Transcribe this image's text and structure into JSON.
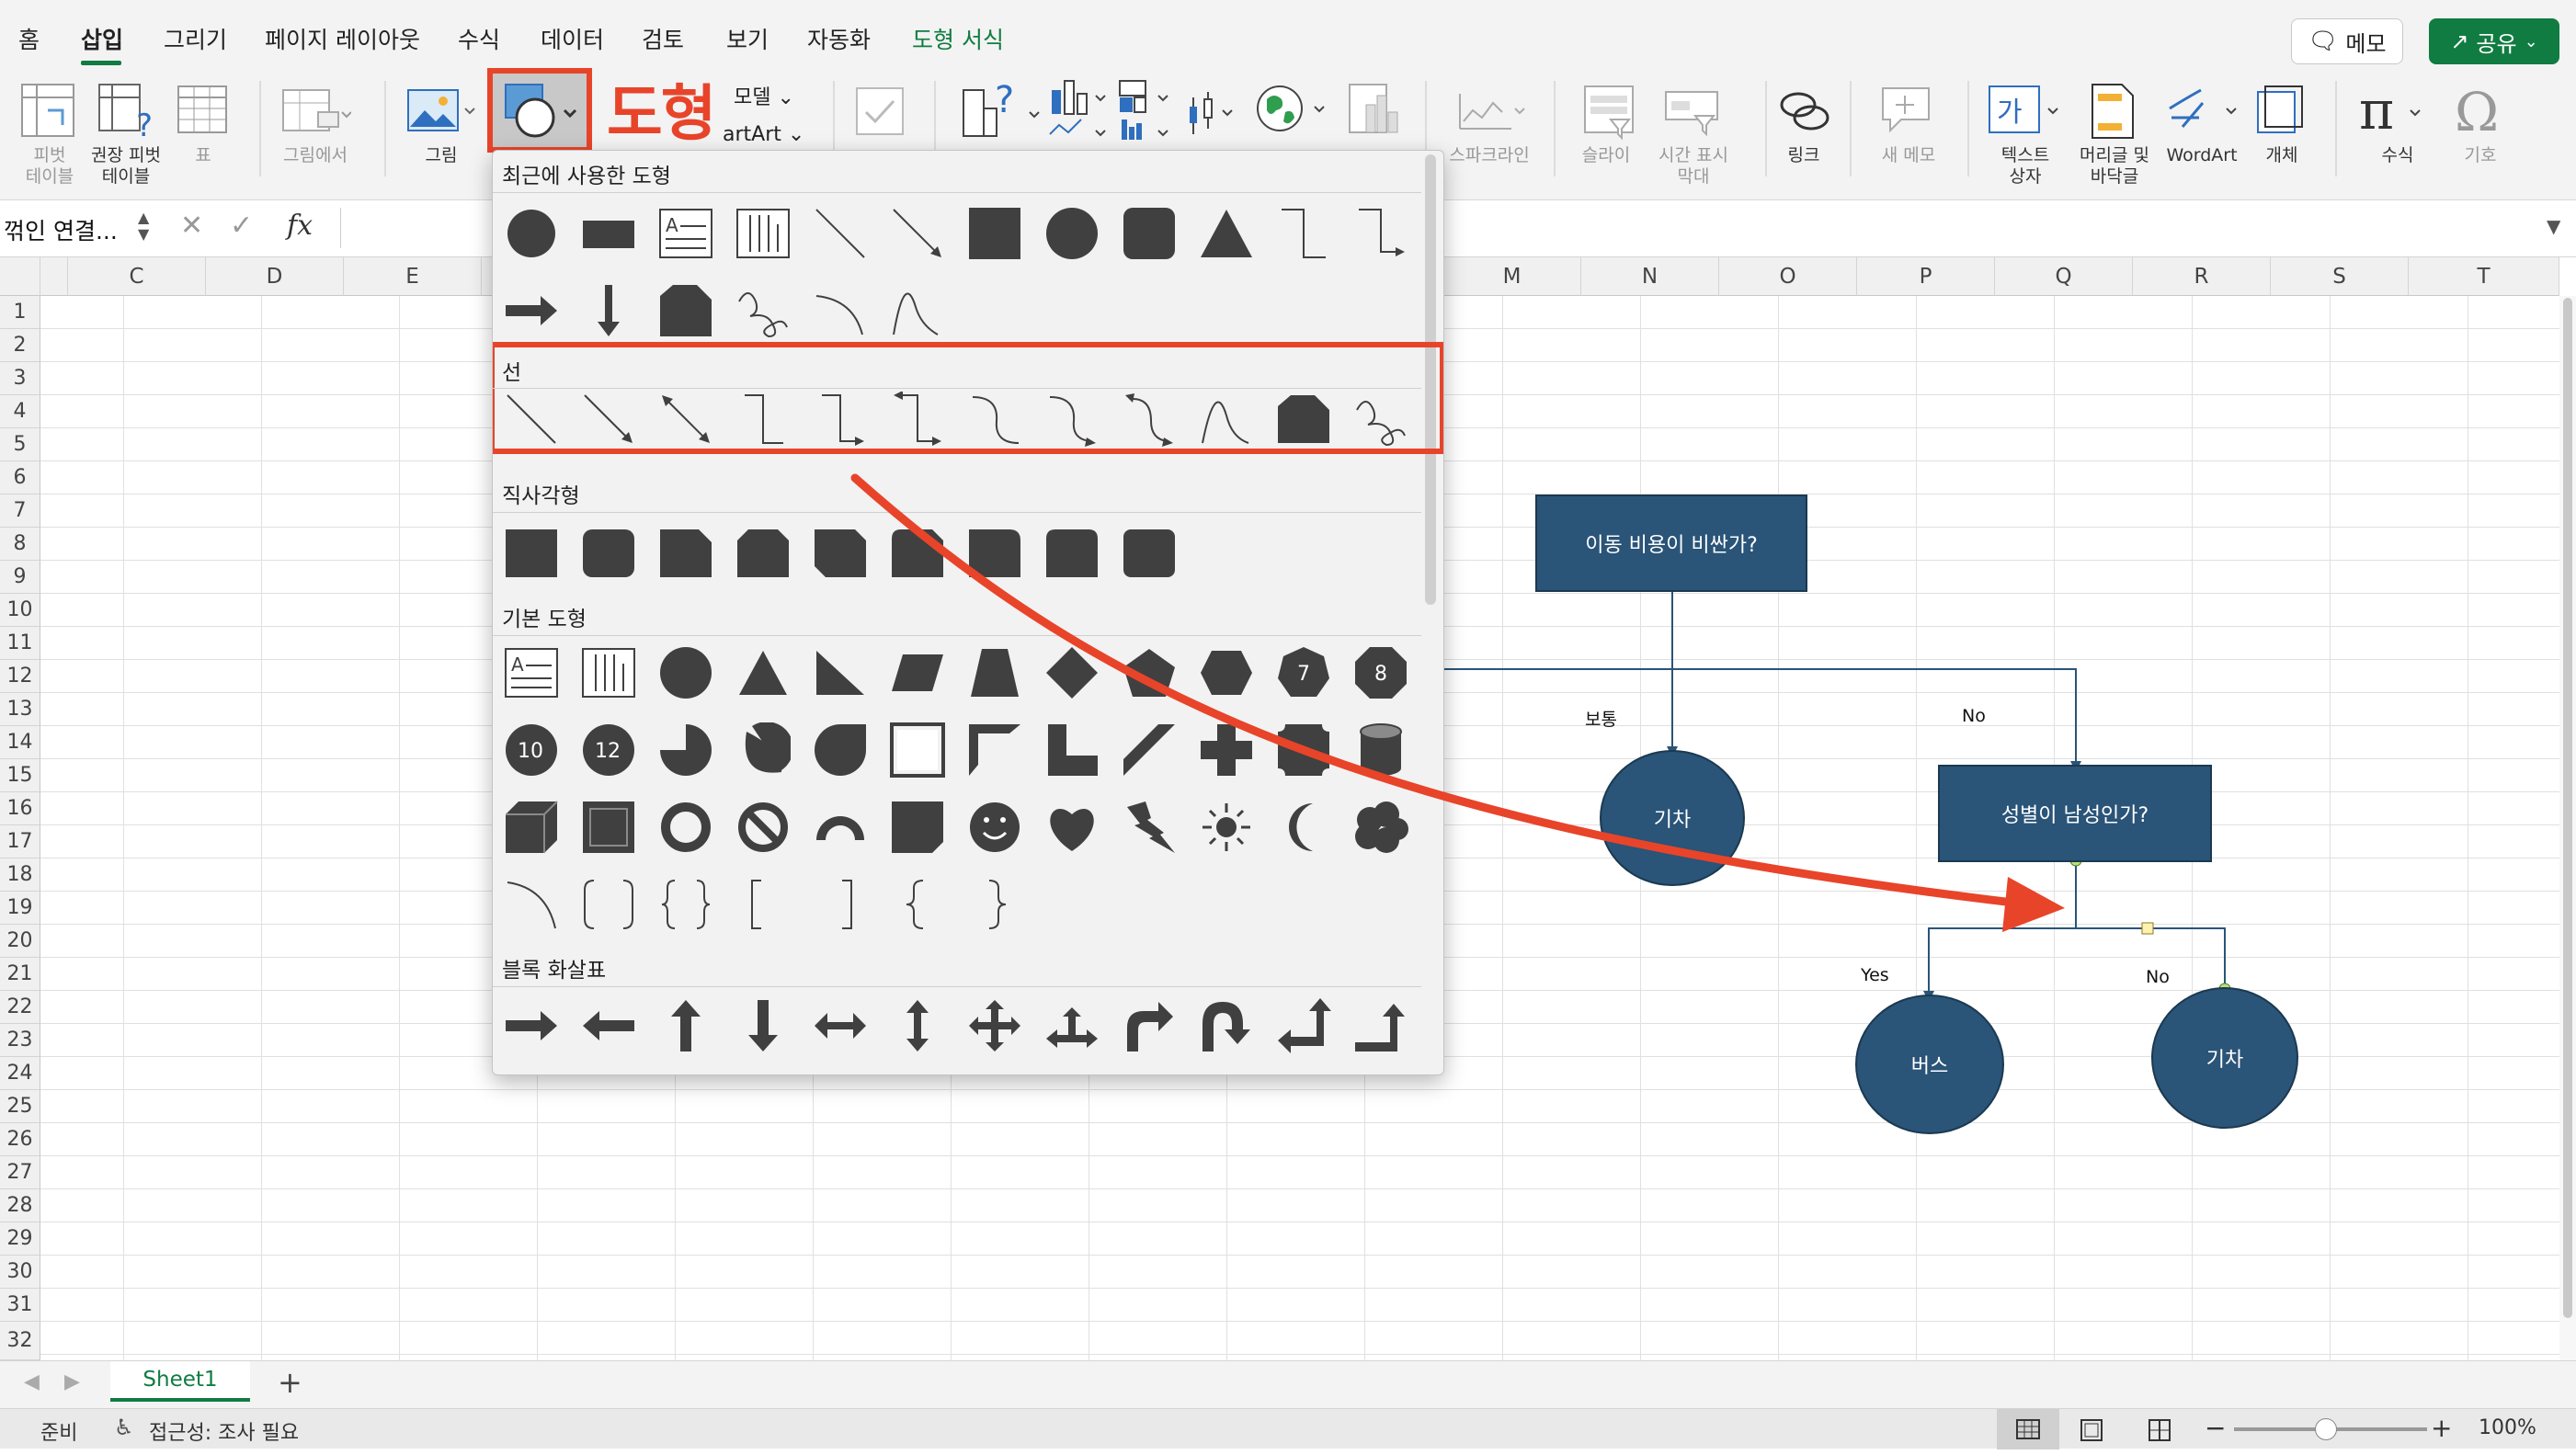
{
  "tabs": [
    "홈",
    "삽입",
    "그리기",
    "페이지 레이아웃",
    "수식",
    "데이터",
    "검토",
    "보기",
    "자동화",
    "도형 서식"
  ],
  "top_buttons": {
    "memo": "메모",
    "share": "공유"
  },
  "ribbon": {
    "pivot": "피벗\n테이블",
    "recommended_pivot": "권장 피벗\n테이블",
    "table": "표",
    "from_picture": "그림에서",
    "picture": "그림",
    "shapes_callout": "도형",
    "model": "모델",
    "smartart": "artArt",
    "sparkline": "스파크라인",
    "slicer": "슬라이",
    "timeline": "시간 표시\n막대",
    "link": "링크",
    "new_memo": "새 메모",
    "textbox": "텍스트\n상자",
    "header_footer": "머리글 및\n바닥글",
    "wordart": "WordArt",
    "object": "개체",
    "equation": "수식",
    "symbol": "기호"
  },
  "formula_bar": {
    "name_box": "꺾인 연결...",
    "fx": "fx",
    "value": ""
  },
  "columns_left": [
    "C",
    "D",
    "E"
  ],
  "columns_right": [
    "M",
    "N",
    "O",
    "P",
    "Q",
    "R",
    "S",
    "T"
  ],
  "rows": [
    "1",
    "2",
    "3",
    "4",
    "5",
    "6",
    "7",
    "8",
    "9",
    "10",
    "11",
    "12",
    "13",
    "14",
    "15",
    "16",
    "17",
    "18",
    "19",
    "20",
    "21",
    "22",
    "23",
    "24",
    "25",
    "26",
    "27",
    "28",
    "29",
    "30",
    "31",
    "32"
  ],
  "shape_panel": {
    "recent": "최근에 사용한 도형",
    "lines": "선",
    "rectangles": "직사각형",
    "basic": "기본 도형",
    "block_arrows": "블록 화살표",
    "octagon_7": "7",
    "octagon_8": "8",
    "decagon_10": "10",
    "dodecagon_12": "12"
  },
  "flowchart": {
    "q1": "이동 비용이 비싼가?",
    "label_normal": "보통",
    "label_no1": "No",
    "train1": "기차",
    "q2": "성별이 남성인가?",
    "label_yes": "Yes",
    "label_no2": "No",
    "bus": "버스",
    "train2": "기차"
  },
  "sheet_tab": "Sheet1",
  "status": {
    "ready": "준비",
    "accessibility": "접근성: 조사 필요",
    "zoom": "100%"
  },
  "colors": {
    "accent": "#107c41",
    "callout": "#e8442a",
    "node_fill": "#2a5478"
  }
}
